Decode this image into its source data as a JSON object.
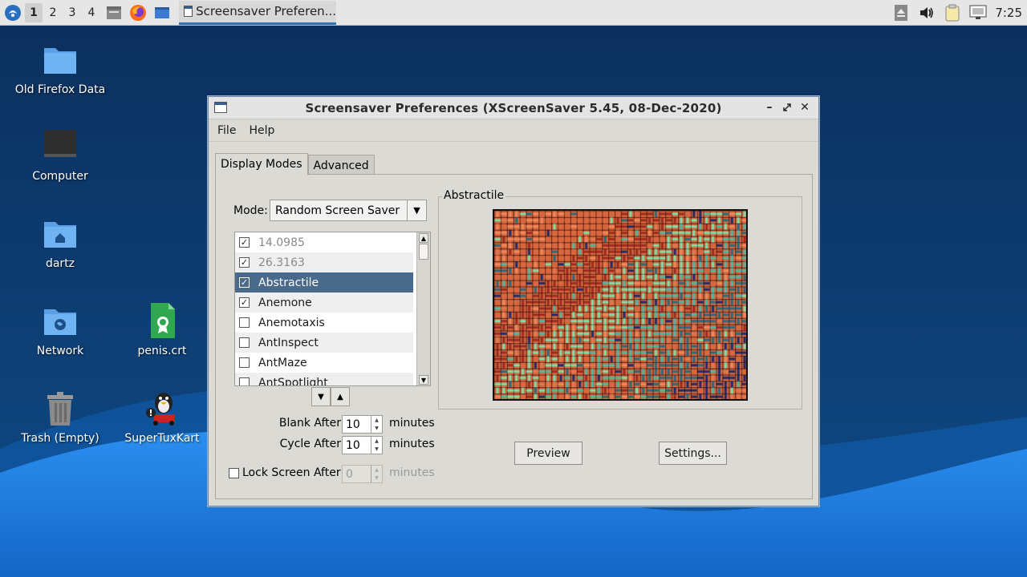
{
  "taskbar": {
    "workspaces": [
      "1",
      "2",
      "3",
      "4"
    ],
    "active_workspace": "1",
    "task_label": "Screensaver Preferen...",
    "clock": "7:25"
  },
  "desktop": {
    "icons": [
      {
        "label": "Old Firefox Data",
        "icon": "folder-icon"
      },
      {
        "label": "Computer",
        "icon": "computer-icon"
      },
      {
        "label": "dartz",
        "icon": "home-folder-icon"
      },
      {
        "label": "Network",
        "icon": "network-folder-icon"
      },
      {
        "label": "penis.crt",
        "icon": "certificate-file-icon"
      },
      {
        "label": "Trash (Empty)",
        "icon": "trash-icon"
      },
      {
        "label": "SuperTuxKart",
        "icon": "supertuxkart-icon"
      }
    ]
  },
  "window": {
    "title": "Screensaver Preferences  (XScreenSaver 5.45, 08-Dec-2020)",
    "menu": [
      "File",
      "Help"
    ],
    "tabs": [
      "Display Modes",
      "Advanced"
    ],
    "mode_label": "Mode:",
    "mode_value": "Random Screen Saver",
    "list": [
      {
        "label": "14.0985",
        "checked": true
      },
      {
        "label": "26.3163",
        "checked": true
      },
      {
        "label": "Abstractile",
        "checked": true
      },
      {
        "label": "Anemone",
        "checked": true
      },
      {
        "label": "Anemotaxis",
        "checked": false
      },
      {
        "label": "AntInspect",
        "checked": false
      },
      {
        "label": "AntMaze",
        "checked": false
      },
      {
        "label": "AntSpotlight",
        "checked": false
      }
    ],
    "blank_after_label": "Blank After",
    "blank_after_value": "10",
    "cycle_after_label": "Cycle After",
    "cycle_after_value": "10",
    "lock_label": "Lock Screen After",
    "lock_value": "0",
    "minutes": "minutes",
    "preview_title": "Abstractile",
    "preview_button": "Preview",
    "settings_button": "Settings..."
  },
  "colors": {
    "selection": "#4a6a8c",
    "desktop_dark": "#0e3a6b",
    "desktop_wave": "#1f7fdc",
    "maze_palette": [
      "#f08a5d",
      "#d8663e",
      "#9a2a20",
      "#7fe0a8",
      "#4fb8a0",
      "#2a6a7a",
      "#1a2a6a",
      "#e07a50"
    ]
  }
}
